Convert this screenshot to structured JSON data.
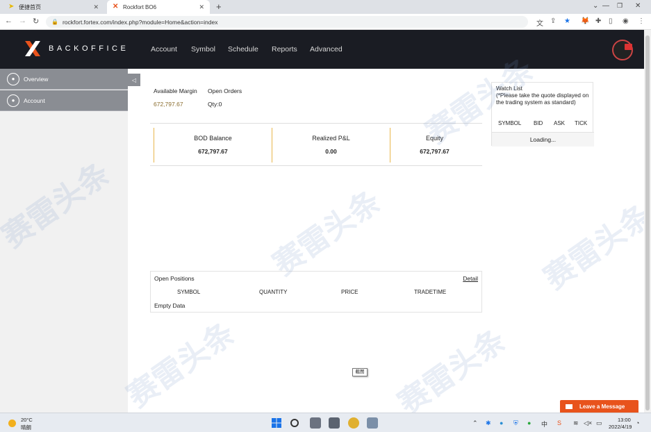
{
  "browser": {
    "tabs": [
      {
        "label": "便捷首页",
        "active": false
      },
      {
        "label": "Rockfort BO6",
        "active": true
      }
    ],
    "new_tab": "+",
    "url": "rockfort.fortex.com/index.php?module=Home&action=index"
  },
  "header": {
    "brand": "BACKOFFICE",
    "nav": [
      "Account",
      "Symbol",
      "Schedule",
      "Reports",
      "Advanced"
    ]
  },
  "sidebar": {
    "items": [
      {
        "label": "Overview"
      },
      {
        "label": "Account"
      }
    ],
    "collapse_icon": "◁"
  },
  "summary": {
    "available_margin_label": "Available Margin",
    "available_margin_value": "672,797.67",
    "open_orders_label": "Open Orders",
    "open_orders_value": "Qty:0"
  },
  "balances": [
    {
      "title": "BOD Balance",
      "value": "672,797.67"
    },
    {
      "title": "Realized P&L",
      "value": "0.00"
    },
    {
      "title": "Equity",
      "value": "672,797.67"
    }
  ],
  "watchlist": {
    "title": "Watch List",
    "note": "(*Please take the quote displayed on the trading system as standard)",
    "columns": [
      "SYMBOL",
      "BID",
      "ASK",
      "TICK"
    ],
    "loading": "Loading..."
  },
  "positions": {
    "title": "Open Positions",
    "detail": "Detail",
    "columns": [
      "SYMBOL",
      "QUANTITY",
      "PRICE",
      "TRADETIME"
    ],
    "empty": "Empty Data"
  },
  "screenshot_tip": "截图",
  "chat": {
    "label": "Leave a Message"
  },
  "taskbar": {
    "temp": "20°C",
    "weather": "晴朗",
    "ime": "中",
    "time": "13:00",
    "date": "2022/4/19"
  },
  "watermark": "赛雷头条",
  "colors": {
    "header_bg": "#1a1c23",
    "accent_orange": "#e8531c",
    "gold": "#e8b64c",
    "sidebar_item": "#8a8d93"
  }
}
